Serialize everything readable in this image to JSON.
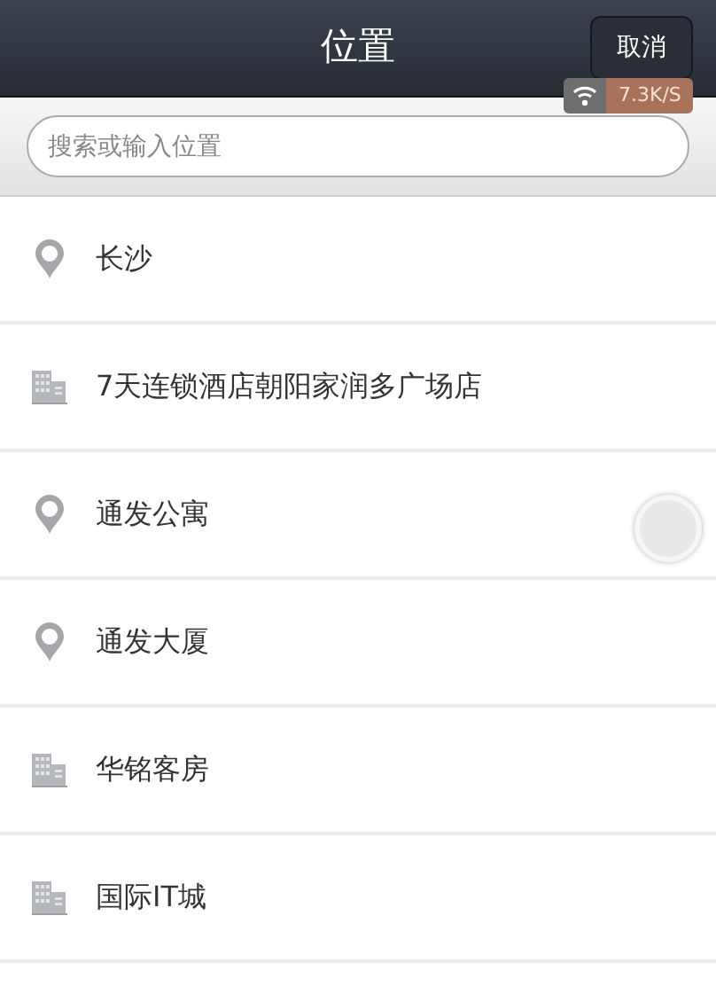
{
  "header": {
    "title": "位置",
    "cancel_button": "取消"
  },
  "network_badge": {
    "speed": "7.3K/S"
  },
  "search": {
    "placeholder": "搜索或输入位置"
  },
  "results": [
    {
      "kind": "place",
      "name": "长沙"
    },
    {
      "kind": "building",
      "name": "7天连锁酒店朝阳家润多广场店"
    },
    {
      "kind": "place",
      "name": "通发公寓"
    },
    {
      "kind": "place",
      "name": "通发大厦"
    },
    {
      "kind": "building",
      "name": "华铭客房"
    },
    {
      "kind": "building",
      "name": "国际IT城"
    }
  ]
}
